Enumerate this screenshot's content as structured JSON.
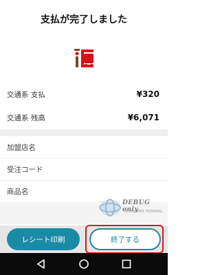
{
  "header": {
    "title": "支払が完了しました"
  },
  "logo": {
    "icon": "ic-card-logo",
    "accent": "#d7101a",
    "brand_brown": "#7a4a2a"
  },
  "payment": {
    "rows": [
      {
        "label": "交通系 支払",
        "value": "¥320"
      },
      {
        "label": "交通系 残高",
        "value": "¥6,071"
      }
    ]
  },
  "info": {
    "rows": [
      {
        "label": "加盟店名"
      },
      {
        "label": "受注コード"
      },
      {
        "label": "商品名"
      }
    ]
  },
  "watermark": {
    "text": "DEBUG only",
    "sub": "DEVELOPER TERMINAL"
  },
  "buttons": {
    "receipt_label": "レシート印刷",
    "finish_label": "終了する"
  },
  "colors": {
    "primary": "#1a8aa5",
    "highlight": "#e0121b"
  },
  "navbar": {
    "icons": [
      "back-icon",
      "home-icon",
      "recent-apps-icon"
    ]
  }
}
